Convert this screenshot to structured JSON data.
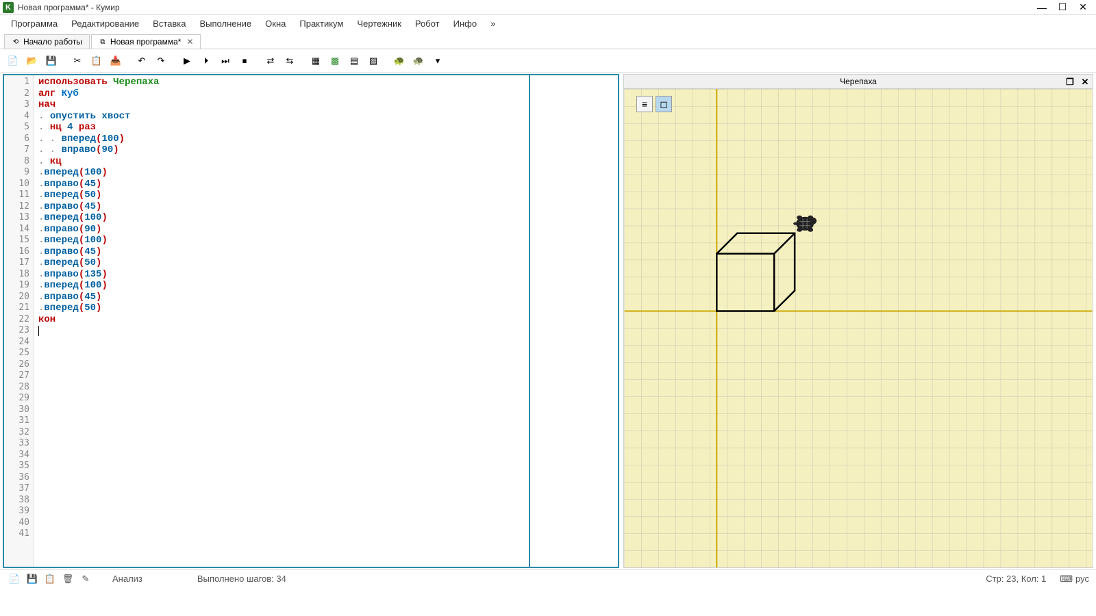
{
  "window": {
    "title": "Новая программа* - Кумир",
    "app_icon_letter": "K"
  },
  "menu": {
    "items": [
      "Программа",
      "Редактирование",
      "Вставка",
      "Выполнение",
      "Окна",
      "Практикум",
      "Чертежник",
      "Робот",
      "Инфо",
      "»"
    ]
  },
  "tabs": {
    "items": [
      {
        "label": "Начало работы",
        "active": false,
        "closable": false
      },
      {
        "label": "Новая программа*",
        "active": true,
        "closable": true
      }
    ]
  },
  "toolbar_icons": [
    "new-file-icon",
    "open-file-icon",
    "save-icon",
    "sep",
    "cut-icon",
    "copy-icon",
    "paste-icon",
    "sep",
    "undo-icon",
    "redo-icon",
    "sep",
    "run-icon",
    "step-icon",
    "step-over-icon",
    "stop-icon",
    "sep",
    "toggle-a-icon",
    "toggle-b-icon",
    "sep",
    "grid1-icon",
    "grid2-icon",
    "grid3-icon",
    "grid4-icon",
    "sep",
    "turtle-green-icon",
    "turtle-dark-icon",
    "more-icon"
  ],
  "code": {
    "lines": [
      {
        "n": 1,
        "raw": "использовать Черепаха",
        "tokens": [
          {
            "t": "использовать",
            "c": "kw"
          },
          {
            "t": " "
          },
          {
            "t": "Черепаха",
            "c": "mod"
          }
        ]
      },
      {
        "n": 2,
        "raw": "алг Куб",
        "tokens": [
          {
            "t": "алг",
            "c": "kw"
          },
          {
            "t": " "
          },
          {
            "t": "Куб",
            "c": "alg"
          }
        ]
      },
      {
        "n": 3,
        "raw": "нач",
        "tokens": [
          {
            "t": "нач",
            "c": "kw"
          }
        ]
      },
      {
        "n": 4,
        "raw": ". опустить хвост",
        "tokens": [
          {
            "t": ". ",
            "c": "dot"
          },
          {
            "t": "опустить хвост",
            "c": "cmd"
          }
        ]
      },
      {
        "n": 5,
        "raw": ". нц 4 раз",
        "tokens": [
          {
            "t": ". ",
            "c": "dot"
          },
          {
            "t": "нц",
            "c": "kw"
          },
          {
            "t": " "
          },
          {
            "t": "4",
            "c": "num"
          },
          {
            "t": " "
          },
          {
            "t": "раз",
            "c": "kw"
          }
        ]
      },
      {
        "n": 6,
        "raw": ". . вперед(100)",
        "tokens": [
          {
            "t": ". . ",
            "c": "dot"
          },
          {
            "t": "вперед",
            "c": "cmd"
          },
          {
            "t": "(",
            "c": "paren"
          },
          {
            "t": "100",
            "c": "num"
          },
          {
            "t": ")",
            "c": "paren"
          }
        ]
      },
      {
        "n": 7,
        "raw": ". . вправо(90)",
        "tokens": [
          {
            "t": ". . ",
            "c": "dot"
          },
          {
            "t": "вправо",
            "c": "cmd"
          },
          {
            "t": "(",
            "c": "paren"
          },
          {
            "t": "90",
            "c": "num"
          },
          {
            "t": ")",
            "c": "paren"
          }
        ]
      },
      {
        "n": 8,
        "raw": ". кц",
        "tokens": [
          {
            "t": ". ",
            "c": "dot"
          },
          {
            "t": "кц",
            "c": "kw"
          }
        ]
      },
      {
        "n": 9,
        "raw": ".вперед(100)",
        "tokens": [
          {
            "t": ".",
            "c": "dot"
          },
          {
            "t": "вперед",
            "c": "cmd"
          },
          {
            "t": "(",
            "c": "paren"
          },
          {
            "t": "100",
            "c": "num"
          },
          {
            "t": ")",
            "c": "paren"
          }
        ]
      },
      {
        "n": 10,
        "raw": ".вправо(45)",
        "tokens": [
          {
            "t": ".",
            "c": "dot"
          },
          {
            "t": "вправо",
            "c": "cmd"
          },
          {
            "t": "(",
            "c": "paren"
          },
          {
            "t": "45",
            "c": "num"
          },
          {
            "t": ")",
            "c": "paren"
          }
        ]
      },
      {
        "n": 11,
        "raw": ".вперед(50)",
        "tokens": [
          {
            "t": ".",
            "c": "dot"
          },
          {
            "t": "вперед",
            "c": "cmd"
          },
          {
            "t": "(",
            "c": "paren"
          },
          {
            "t": "50",
            "c": "num"
          },
          {
            "t": ")",
            "c": "paren"
          }
        ]
      },
      {
        "n": 12,
        "raw": ".вправо(45)",
        "tokens": [
          {
            "t": ".",
            "c": "dot"
          },
          {
            "t": "вправо",
            "c": "cmd"
          },
          {
            "t": "(",
            "c": "paren"
          },
          {
            "t": "45",
            "c": "num"
          },
          {
            "t": ")",
            "c": "paren"
          }
        ]
      },
      {
        "n": 13,
        "raw": ".вперед(100)",
        "tokens": [
          {
            "t": ".",
            "c": "dot"
          },
          {
            "t": "вперед",
            "c": "cmd"
          },
          {
            "t": "(",
            "c": "paren"
          },
          {
            "t": "100",
            "c": "num"
          },
          {
            "t": ")",
            "c": "paren"
          }
        ]
      },
      {
        "n": 14,
        "raw": ".вправо(90)",
        "tokens": [
          {
            "t": ".",
            "c": "dot"
          },
          {
            "t": "вправо",
            "c": "cmd"
          },
          {
            "t": "(",
            "c": "paren"
          },
          {
            "t": "90",
            "c": "num"
          },
          {
            "t": ")",
            "c": "paren"
          }
        ]
      },
      {
        "n": 15,
        "raw": ".вперед(100)",
        "tokens": [
          {
            "t": ".",
            "c": "dot"
          },
          {
            "t": "вперед",
            "c": "cmd"
          },
          {
            "t": "(",
            "c": "paren"
          },
          {
            "t": "100",
            "c": "num"
          },
          {
            "t": ")",
            "c": "paren"
          }
        ]
      },
      {
        "n": 16,
        "raw": ".вправо(45)",
        "tokens": [
          {
            "t": ".",
            "c": "dot"
          },
          {
            "t": "вправо",
            "c": "cmd"
          },
          {
            "t": "(",
            "c": "paren"
          },
          {
            "t": "45",
            "c": "num"
          },
          {
            "t": ")",
            "c": "paren"
          }
        ]
      },
      {
        "n": 17,
        "raw": ".вперед(50)",
        "tokens": [
          {
            "t": ".",
            "c": "dot"
          },
          {
            "t": "вперед",
            "c": "cmd"
          },
          {
            "t": "(",
            "c": "paren"
          },
          {
            "t": "50",
            "c": "num"
          },
          {
            "t": ")",
            "c": "paren"
          }
        ]
      },
      {
        "n": 18,
        "raw": ".вправо(135)",
        "tokens": [
          {
            "t": ".",
            "c": "dot"
          },
          {
            "t": "вправо",
            "c": "cmd"
          },
          {
            "t": "(",
            "c": "paren"
          },
          {
            "t": "135",
            "c": "num"
          },
          {
            "t": ")",
            "c": "paren"
          }
        ]
      },
      {
        "n": 19,
        "raw": ".вперед(100)",
        "tokens": [
          {
            "t": ".",
            "c": "dot"
          },
          {
            "t": "вперед",
            "c": "cmd"
          },
          {
            "t": "(",
            "c": "paren"
          },
          {
            "t": "100",
            "c": "num"
          },
          {
            "t": ")",
            "c": "paren"
          }
        ]
      },
      {
        "n": 20,
        "raw": ".вправо(45)",
        "tokens": [
          {
            "t": ".",
            "c": "dot"
          },
          {
            "t": "вправо",
            "c": "cmd"
          },
          {
            "t": "(",
            "c": "paren"
          },
          {
            "t": "45",
            "c": "num"
          },
          {
            "t": ")",
            "c": "paren"
          }
        ]
      },
      {
        "n": 21,
        "raw": ".вперед(50)",
        "tokens": [
          {
            "t": ".",
            "c": "dot"
          },
          {
            "t": "вперед",
            "c": "cmd"
          },
          {
            "t": "(",
            "c": "paren"
          },
          {
            "t": "50",
            "c": "num"
          },
          {
            "t": ")",
            "c": "paren"
          }
        ]
      },
      {
        "n": 22,
        "raw": "кон",
        "tokens": [
          {
            "t": "кон",
            "c": "kw"
          }
        ]
      },
      {
        "n": 23,
        "raw": "",
        "tokens": []
      }
    ],
    "total_visible_lines": 41
  },
  "turtle": {
    "title": "Черепаха"
  },
  "status": {
    "analysis": "Анализ",
    "steps": "Выполнено шагов: 34",
    "cursor": "Стр: 23, Кол: 1",
    "lang": "рус"
  }
}
